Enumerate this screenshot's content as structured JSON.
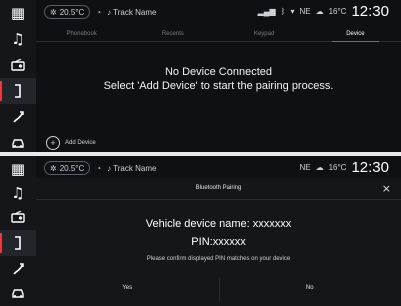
{
  "top": {
    "status": {
      "temp": "20.5°C",
      "track": "Track Name",
      "gps": "NE",
      "outside_temp": "16°C",
      "clock": "12:30"
    },
    "tabs": [
      {
        "label": "Phonebook"
      },
      {
        "label": "Recents"
      },
      {
        "label": "Keypad"
      },
      {
        "label": "Device"
      }
    ],
    "message": {
      "line1": "No Device Connected",
      "line2": "Select 'Add Device' to start the pairing process."
    },
    "add_device": "Add Device"
  },
  "bottom": {
    "status": {
      "temp": "20.5°C",
      "track": "Track Name",
      "gps": "NE",
      "outside_temp": "16°C",
      "clock": "12:30"
    },
    "dialog": {
      "title": "Bluetooth Pairing",
      "close": "×",
      "device_name": "Vehicle device name: xxxxxxx",
      "pin": "PIN:xxxxxx",
      "confirm": "Please confirm displayed PIN matches on your device",
      "yes": "Yes",
      "no": "No"
    }
  },
  "sidebar_icons": [
    "apps-grid-icon",
    "music-note-icon",
    "radio-icon",
    "phone-icon",
    "navigation-icon",
    "car-icon"
  ],
  "accent_color": "#e23b44"
}
